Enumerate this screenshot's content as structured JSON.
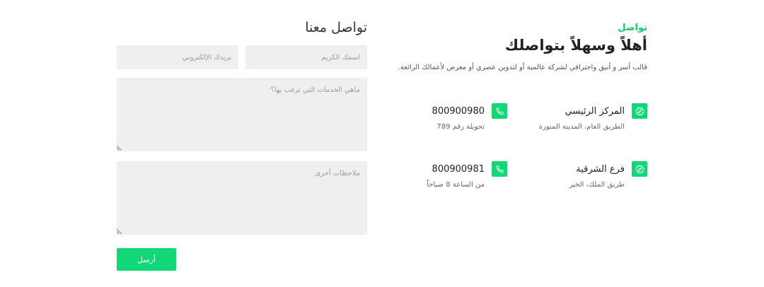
{
  "info": {
    "eyebrow": "تواصل",
    "title": "أهلاً وسهلاً بتواصلك",
    "description": "قالب أسر و أنيق واحترافي لشركة عالمية أو لتدوين عصري أو معرض لأعمالك الرائعة.",
    "locations": [
      {
        "title": "المركز الرئيسي",
        "subtitle": "الطريق العام، المدينة المنورة",
        "icon": "compass-icon"
      },
      {
        "title": "فرع الشرقية",
        "subtitle": "طريق الملك، الخبر",
        "icon": "compass-icon"
      }
    ],
    "phones": [
      {
        "number": "800900980",
        "subtitle": "تحويلة رقم 789",
        "icon": "phone-icon"
      },
      {
        "number": "800900981",
        "subtitle": "من الساعة 8 صباحاً",
        "icon": "phone-icon"
      }
    ],
    "accent_color": "#10d876"
  },
  "form": {
    "title": "تواصل معنا",
    "name_placeholder": "اسمك الكريم",
    "email_placeholder": "بريدك الإلكتروني",
    "services_placeholder": "ماهي الخدمات التي ترغب بها؟",
    "notes_placeholder": "ملاحظات أخرى",
    "submit_label": "أرسل"
  }
}
